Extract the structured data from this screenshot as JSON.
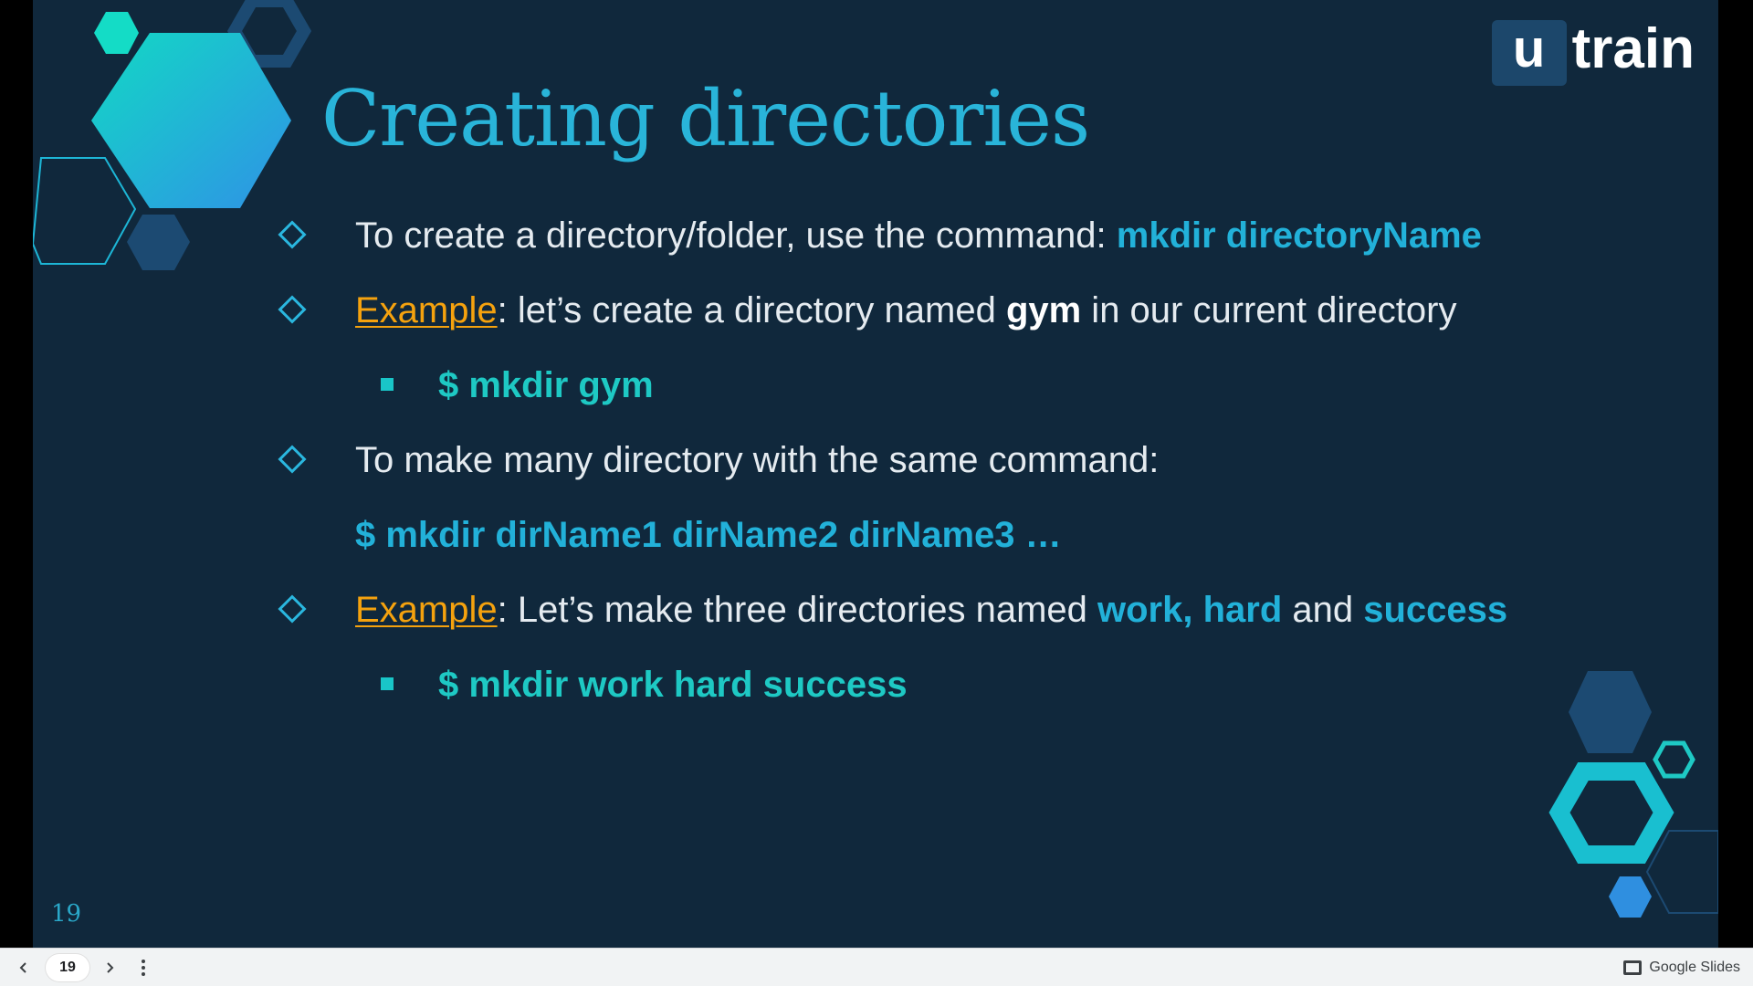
{
  "slide": {
    "title": "Creating directories",
    "logo": {
      "u": "u",
      "train": "train"
    },
    "slide_number": "19",
    "bullets": {
      "b1_text": "To create a directory/folder, use the command: ",
      "b1_cmd": "mkdir directoryName",
      "b2_example": "Example",
      "b2_text_a": ": let’s create a directory named ",
      "b2_bold": "gym",
      "b2_text_b": " in our current directory",
      "s1_cmd": "$ mkdir gym",
      "b3_text": "To make many directory with the same command:",
      "b3_cmd": "$ mkdir dirName1 dirName2 dirName3 …",
      "b4_example": "Example",
      "b4_text_a": ": Let’s make three directories named ",
      "b4_hl1": "work, hard",
      "b4_text_b": " and ",
      "b4_hl2": "success",
      "s2_cmd": "$ mkdir work hard success"
    }
  },
  "toolbar": {
    "prev_icon": "chevron-left-icon",
    "page_number": "19",
    "next_icon": "chevron-right-icon",
    "menu_icon": "more-vert-icon",
    "brand_label": "Google Slides"
  },
  "colors": {
    "background": "#10283c",
    "accent_blue": "#29b4d9",
    "accent_orange": "#f5a20e",
    "accent_teal": "#1ec9c4"
  }
}
